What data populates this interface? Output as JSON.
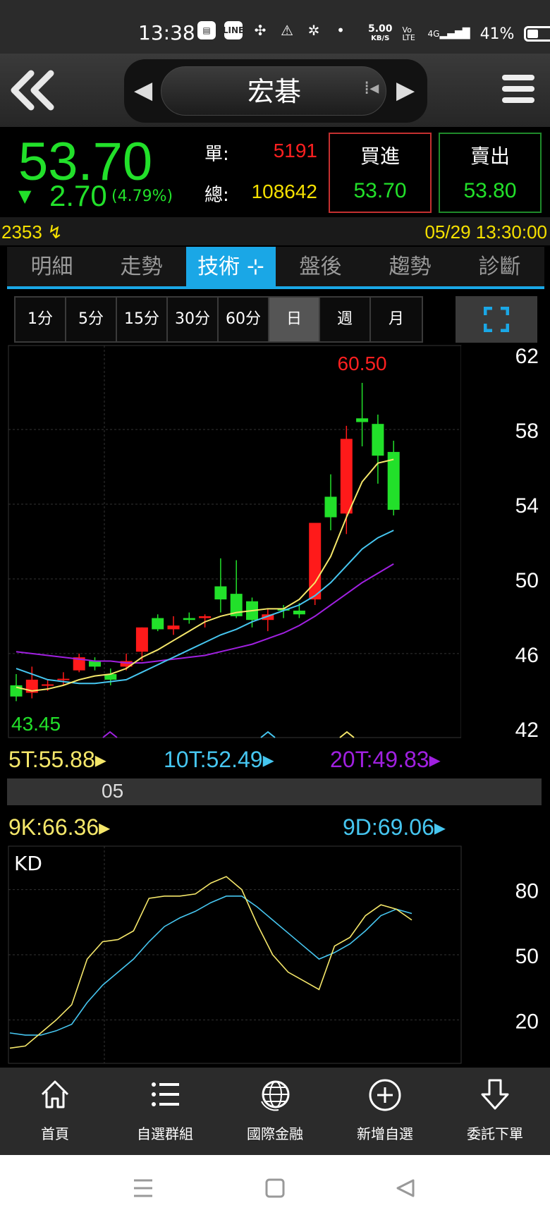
{
  "status_bar": {
    "time": "13:38",
    "speed_value": "5.00",
    "speed_unit": "KB/S",
    "volte": "Vo LTE",
    "network": "4G",
    "battery": "41%",
    "battery_level": 0.41
  },
  "header": {
    "title": "宏碁"
  },
  "quote": {
    "price": "53.70",
    "change": "2.70",
    "change_pct": "(4.79%)",
    "single_label": "單:",
    "single_value": "5191",
    "total_label": "總:",
    "total_value": "108642",
    "buy_label": "買進",
    "buy_price": "53.70",
    "sell_label": "賣出",
    "sell_price": "53.80",
    "code": "2353",
    "datetime": "05/29 13:30:00"
  },
  "tabs": [
    "明細",
    "走勢",
    "技術",
    "盤後",
    "趨勢",
    "診斷"
  ],
  "active_tab": 2,
  "periods": [
    "1分",
    "5分",
    "15分",
    "30分",
    "60分",
    "日",
    "週",
    "月"
  ],
  "active_period": 5,
  "colors": {
    "up": "#ff1a1a",
    "down": "#22e02a",
    "ma5": "#f5e76a",
    "ma10": "#46c6f0",
    "ma20": "#a020e0",
    "accent": "#1aa7e6"
  },
  "chart_data": [
    {
      "type": "candlestick",
      "title": "",
      "high_label": "60.50",
      "low_label": "43.45",
      "yticks": [
        62,
        58,
        54,
        50,
        46,
        42
      ],
      "ylim": [
        41.5,
        62.5
      ],
      "candles": [
        {
          "o": 44.3,
          "h": 44.9,
          "l": 43.45,
          "c": 43.7
        },
        {
          "o": 43.9,
          "h": 45.3,
          "l": 43.6,
          "c": 44.6
        },
        {
          "o": 44.3,
          "h": 44.6,
          "l": 44.0,
          "c": 44.35
        },
        {
          "o": 44.6,
          "h": 45.0,
          "l": 44.3,
          "c": 44.65
        },
        {
          "o": 45.1,
          "h": 46.0,
          "l": 45.0,
          "c": 45.8
        },
        {
          "o": 45.6,
          "h": 45.8,
          "l": 45.1,
          "c": 45.3
        },
        {
          "o": 44.9,
          "h": 45.2,
          "l": 44.3,
          "c": 44.6
        },
        {
          "o": 45.3,
          "h": 46.0,
          "l": 45.1,
          "c": 45.6
        },
        {
          "o": 46.1,
          "h": 47.4,
          "l": 45.6,
          "c": 47.4
        },
        {
          "o": 47.9,
          "h": 48.1,
          "l": 47.2,
          "c": 47.3
        },
        {
          "o": 47.3,
          "h": 48.0,
          "l": 47.0,
          "c": 47.5
        },
        {
          "o": 47.9,
          "h": 48.2,
          "l": 47.6,
          "c": 47.8
        },
        {
          "o": 47.9,
          "h": 48.1,
          "l": 47.4,
          "c": 48.0
        },
        {
          "o": 49.6,
          "h": 51.1,
          "l": 48.2,
          "c": 48.9
        },
        {
          "o": 49.2,
          "h": 51.0,
          "l": 47.9,
          "c": 48.0
        },
        {
          "o": 48.8,
          "h": 49.0,
          "l": 47.4,
          "c": 47.8
        },
        {
          "o": 47.8,
          "h": 48.4,
          "l": 47.2,
          "c": 48.1
        },
        {
          "o": 48.4,
          "h": 48.6,
          "l": 47.9,
          "c": 48.3
        },
        {
          "o": 48.3,
          "h": 48.7,
          "l": 47.9,
          "c": 48.1
        },
        {
          "o": 48.9,
          "h": 51.2,
          "l": 48.6,
          "c": 53.0
        },
        {
          "o": 54.4,
          "h": 55.6,
          "l": 52.6,
          "c": 53.3
        },
        {
          "o": 53.5,
          "h": 58.2,
          "l": 52.4,
          "c": 57.5
        },
        {
          "o": 58.6,
          "h": 60.5,
          "l": 57.1,
          "c": 58.4
        },
        {
          "o": 58.3,
          "h": 58.8,
          "l": 55.1,
          "c": 56.6
        },
        {
          "o": 56.8,
          "h": 57.4,
          "l": 53.4,
          "c": 53.7
        }
      ],
      "ma5": [
        44.2,
        44.0,
        44.1,
        44.3,
        44.6,
        44.8,
        44.9,
        45.2,
        45.8,
        46.2,
        46.7,
        47.2,
        47.7,
        48.0,
        48.2,
        48.3,
        48.4,
        48.4,
        48.9,
        49.8,
        51.2,
        53.3,
        55.2,
        56.2,
        56.4
      ],
      "ma10": [
        45.2,
        44.9,
        44.6,
        44.5,
        44.4,
        44.4,
        44.5,
        44.6,
        45.0,
        45.4,
        45.8,
        46.2,
        46.6,
        47.0,
        47.3,
        47.7,
        48.0,
        48.3,
        48.6,
        49.1,
        49.8,
        50.7,
        51.6,
        52.2,
        52.6
      ],
      "ma20": [
        46.1,
        46.0,
        45.9,
        45.8,
        45.7,
        45.6,
        45.6,
        45.5,
        45.5,
        45.6,
        45.7,
        45.8,
        45.9,
        46.1,
        46.3,
        46.5,
        46.8,
        47.1,
        47.5,
        48.0,
        48.6,
        49.2,
        49.8,
        50.3,
        50.8
      ],
      "legend": [
        {
          "name": "5T",
          "value": "55.88"
        },
        {
          "name": "10T",
          "value": "52.49"
        },
        {
          "name": "20T",
          "value": "49.83"
        }
      ],
      "x_label": "05"
    },
    {
      "type": "line",
      "title": "KD",
      "yticks": [
        80,
        50,
        20
      ],
      "ylim": [
        0,
        100
      ],
      "series": [
        {
          "name": "9K",
          "value_label": "66.36",
          "values": [
            7,
            8,
            14,
            20,
            27,
            48,
            56,
            57,
            61,
            76,
            77,
            77,
            78,
            83,
            86,
            80,
            64,
            50,
            42,
            38,
            34,
            54,
            58,
            68,
            73,
            71,
            66
          ]
        },
        {
          "name": "9D",
          "value_label": "69.06",
          "values": [
            14,
            13,
            13,
            15,
            18,
            28,
            36,
            42,
            48,
            56,
            63,
            67,
            70,
            74,
            77,
            77,
            72,
            66,
            60,
            54,
            48,
            51,
            55,
            61,
            68,
            71,
            69
          ]
        }
      ]
    }
  ],
  "bottom_nav": [
    "首頁",
    "自選群組",
    "國際金融",
    "新增自選",
    "委託下單"
  ]
}
